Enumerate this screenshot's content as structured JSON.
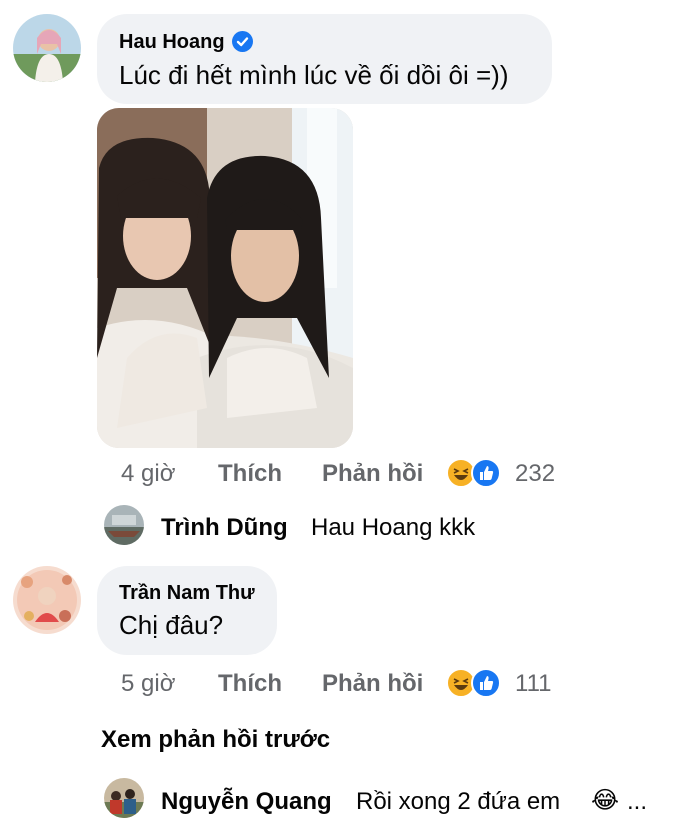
{
  "comments": [
    {
      "author": "Hau Hoang",
      "verified": true,
      "text": "Lúc đi hết mình lúc về ối dồi ôi =))",
      "has_photo": true,
      "time": "4 giờ",
      "like_label": "Thích",
      "reply_label": "Phản hồi",
      "reactions": [
        "haha",
        "like"
      ],
      "reaction_count": "232",
      "reply": {
        "author": "Trình Dũng",
        "text": "Hau Hoang kkk"
      }
    },
    {
      "author": "Trần Nam Thư",
      "verified": false,
      "text": "Chị đâu?",
      "time": "5 giờ",
      "like_label": "Thích",
      "reply_label": "Phản hồi",
      "reactions": [
        "haha",
        "like"
      ],
      "reaction_count": "111",
      "see_previous": "Xem phản hồi trước",
      "reply": {
        "author": "Nguyễn Quang",
        "text": "Rồi xong 2 đứa em",
        "emoji": "😂",
        "ellipsis": "..."
      }
    }
  ],
  "colors": {
    "bubble": "#f0f2f5",
    "meta_text": "#65676b",
    "like_blue": "#1877f2",
    "haha_yellow": "#f7b125"
  }
}
